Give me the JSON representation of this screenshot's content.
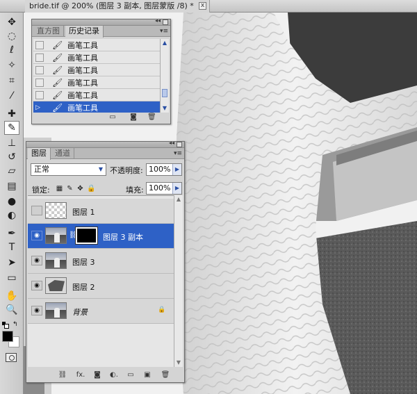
{
  "document": {
    "tab_title": "bride.tif @ 200% (图层 3 副本, 图层蒙版 /8) *",
    "close_glyph": "x"
  },
  "toolbar": {
    "tools": [
      {
        "name": "move-tool",
        "glyph": "✥"
      },
      {
        "name": "marquee-tool",
        "glyph": "◌"
      },
      {
        "name": "lasso-tool",
        "glyph": "ℓ"
      },
      {
        "name": "magic-wand-tool",
        "glyph": "✧"
      },
      {
        "name": "crop-tool",
        "glyph": "⌗"
      },
      {
        "name": "eyedropper-tool",
        "glyph": "⁄"
      },
      {
        "name": "healing-brush-tool",
        "glyph": "✚"
      },
      {
        "name": "brush-tool",
        "glyph": "✎",
        "active": true
      },
      {
        "name": "clone-stamp-tool",
        "glyph": "⊥"
      },
      {
        "name": "history-brush-tool",
        "glyph": "↺"
      },
      {
        "name": "eraser-tool",
        "glyph": "▱"
      },
      {
        "name": "gradient-tool",
        "glyph": "▤"
      },
      {
        "name": "blur-tool",
        "glyph": "●"
      },
      {
        "name": "dodge-tool",
        "glyph": "◐"
      },
      {
        "name": "pen-tool",
        "glyph": "✒"
      },
      {
        "name": "type-tool",
        "glyph": "T"
      },
      {
        "name": "path-selection-tool",
        "glyph": "➤"
      },
      {
        "name": "rectangle-tool",
        "glyph": "▭"
      },
      {
        "name": "hand-tool",
        "glyph": "✋"
      },
      {
        "name": "zoom-tool",
        "glyph": "🔍"
      }
    ],
    "colors": {
      "foreground": "#000000",
      "background": "#ffffff"
    }
  },
  "history_panel": {
    "tabs": [
      "直方图",
      "历史记录"
    ],
    "active_tab": 1,
    "items": [
      {
        "label": "画笔工具",
        "selected": false
      },
      {
        "label": "画笔工具",
        "selected": false
      },
      {
        "label": "画笔工具",
        "selected": false
      },
      {
        "label": "画笔工具",
        "selected": false
      },
      {
        "label": "画笔工具",
        "selected": false
      },
      {
        "label": "画笔工具",
        "selected": true
      }
    ]
  },
  "layers_panel": {
    "tabs": [
      "图层",
      "通道"
    ],
    "active_tab": 0,
    "blend_mode": "正常",
    "opacity_label": "不透明度:",
    "opacity_value": "100%",
    "lock_label": "锁定:",
    "fill_label": "填充:",
    "fill_value": "100%",
    "layers": [
      {
        "name": "图层 1",
        "visible": false,
        "thumb": "checker",
        "mask": false,
        "selected": false,
        "italic": false,
        "locked": false
      },
      {
        "name": "图层 3 副本",
        "visible": true,
        "thumb": "photo",
        "mask": true,
        "selected": true,
        "italic": false,
        "locked": false
      },
      {
        "name": "图层 3",
        "visible": true,
        "thumb": "photo",
        "mask": false,
        "selected": false,
        "italic": false,
        "locked": false
      },
      {
        "name": "图层 2",
        "visible": true,
        "thumb": "shape",
        "mask": false,
        "selected": false,
        "italic": false,
        "locked": false
      },
      {
        "name": "背景",
        "visible": true,
        "thumb": "photo",
        "mask": false,
        "selected": false,
        "italic": true,
        "locked": true
      }
    ],
    "footer_icons": [
      "link-icon",
      "fx-icon",
      "add-mask-icon",
      "adjustment-icon",
      "group-folder-icon",
      "new-layer-icon",
      "delete-icon"
    ],
    "footer_glyphs": [
      "⛓",
      "fx.",
      "◙",
      "◐.",
      "▭",
      "▣",
      "🗑"
    ]
  }
}
